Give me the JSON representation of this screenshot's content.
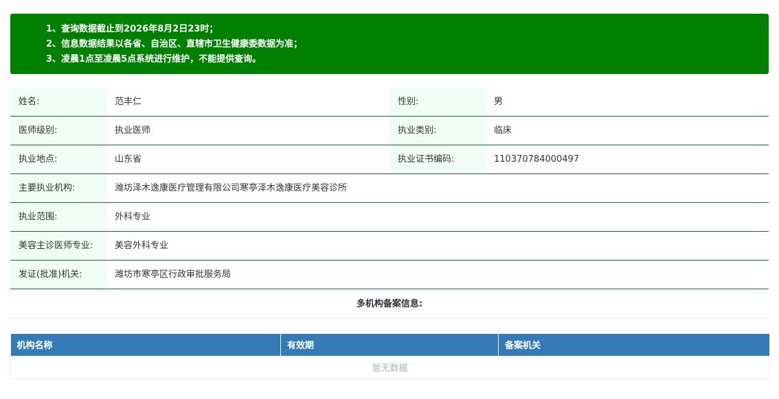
{
  "notice": {
    "lines": [
      "1、查询数据截止到2026年8月2日23时；",
      "2、信息数据结果以各省、自治区、直辖市卫生健康委数据为准；",
      "3、凌晨1点至凌晨5点系统进行维护，不能提供查询。"
    ]
  },
  "info": {
    "name_label": "姓名:",
    "name": "范丰仁",
    "gender_label": "性别:",
    "gender": "男",
    "level_label": "医师级别:",
    "level": "执业医师",
    "category_label": "执业类别:",
    "category": "临床",
    "location_label": "执业地点:",
    "location": "山东省",
    "cert_label": "执业证书编码:",
    "cert": "110370784000497",
    "institution_label": "主要执业机构:",
    "institution": "潍坊泽木逸康医疗管理有限公司寒亭泽木逸康医疗美容诊所",
    "scope_label": "执业范围:",
    "scope": "外科专业",
    "beauty_label": "美容主诊医师专业:",
    "beauty": "美容外科专业",
    "authority_label": "发证(批准)机关:",
    "authority": "潍坊市寒亭区行政审批服务局"
  },
  "records": {
    "title": "多机构备案信息:",
    "columns": [
      "机构名称",
      "有效期",
      "备案机关"
    ],
    "empty_text": "暂无数据"
  },
  "colors": {
    "notice_bg": "#008000",
    "header_bg": "#337ab7",
    "label_bg": "#f0fdf7",
    "row_border": "#1f5d4e"
  }
}
